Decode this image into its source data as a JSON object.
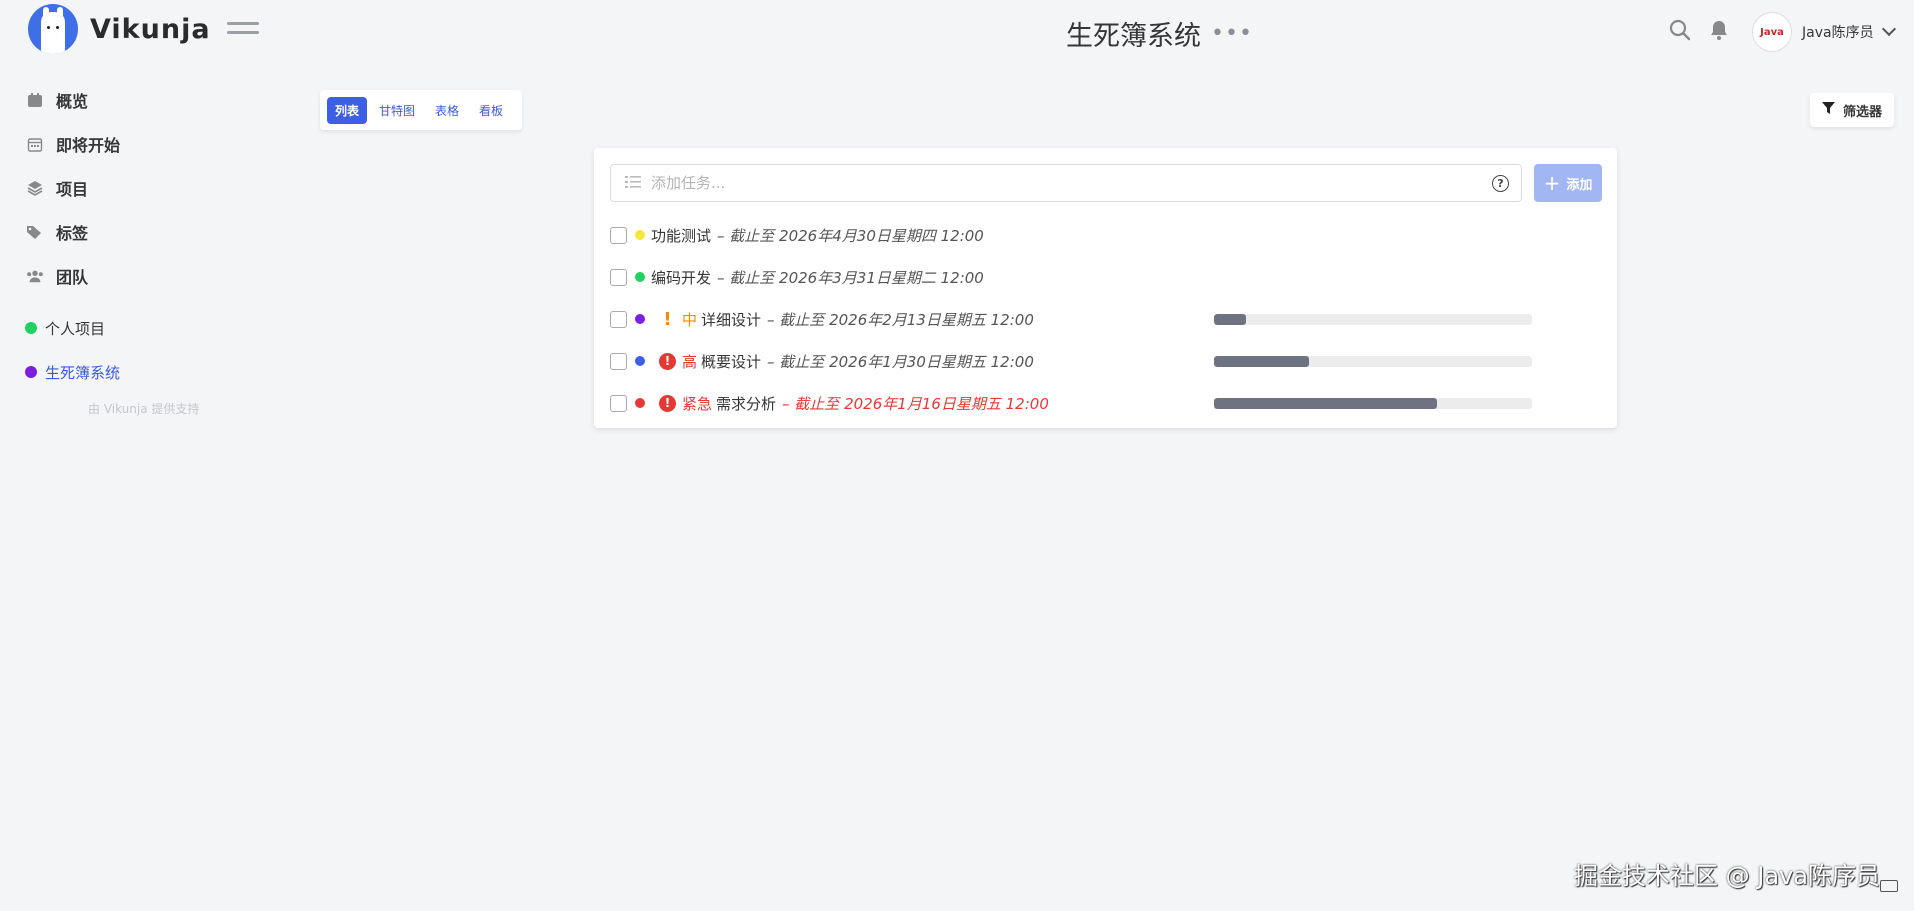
{
  "brand": {
    "name": "Vikunja",
    "accent": "#3f5ee6"
  },
  "header": {
    "project_title": "生死簿系统",
    "title_menu": "•••",
    "user_name": "Java陈序员",
    "avatar_text": "Java"
  },
  "sidebar": {
    "nav": [
      {
        "label": "概览",
        "icon": "calendar-icon"
      },
      {
        "label": "即将开始",
        "icon": "calendar-grid-icon"
      },
      {
        "label": "项目",
        "icon": "layers-icon"
      },
      {
        "label": "标签",
        "icon": "tags-icon"
      },
      {
        "label": "团队",
        "icon": "users-icon"
      }
    ],
    "projects": [
      {
        "label": "个人项目",
        "color": "#1fd163"
      },
      {
        "label": "生死簿系统",
        "color": "#7b1fe0"
      }
    ],
    "powered_by": "由 Vikunja 提供支持"
  },
  "views": {
    "tabs": [
      {
        "label": "列表",
        "active": true
      },
      {
        "label": "甘特图",
        "active": false
      },
      {
        "label": "表格",
        "active": false
      },
      {
        "label": "看板",
        "active": false
      }
    ],
    "filter_label": "筛选器"
  },
  "add_task": {
    "placeholder": "添加任务...",
    "button_label": "添加",
    "help": "?"
  },
  "tasks": [
    {
      "title": "功能测试",
      "due": "– 截止至 2026年4月30日星期四 12:00",
      "color": "#f5e63b",
      "priority": "",
      "priority_icon": "",
      "progress": null,
      "overdue": false
    },
    {
      "title": "编码开发",
      "due": "– 截止至 2026年3月31日星期二 12:00",
      "color": "#1fd163",
      "priority": "",
      "priority_icon": "",
      "progress": null,
      "overdue": false
    },
    {
      "title": "详细设计",
      "due": "– 截止至 2026年2月13日星期五 12:00",
      "color": "#7b1fe0",
      "priority": "中",
      "priority_icon": "!",
      "priority_color": "#f08c00",
      "progress": 0.1,
      "overdue": false
    },
    {
      "title": "概要设计",
      "due": "– 截止至 2026年1月30日星期五 12:00",
      "color": "#3f5ee6",
      "priority": "高",
      "priority_icon": "!",
      "priority_color": "#e53935",
      "progress": 0.3,
      "overdue": false
    },
    {
      "title": "需求分析",
      "due": "– 截止至 2026年1月16日星期五 12:00",
      "color": "#e53935",
      "priority": "紧急",
      "priority_icon": "!",
      "priority_color": "#e53935",
      "progress": 0.7,
      "overdue": true
    }
  ],
  "watermark": "掘金技术社区 @ Java陈序员"
}
